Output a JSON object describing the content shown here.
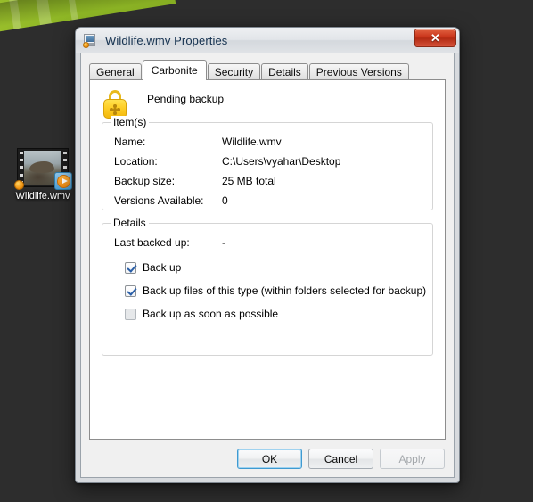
{
  "desktop": {
    "icon": {
      "label": "Wildlife.wmv",
      "thumbnail_icon": "video-thumbnail-icon",
      "play_badge_icon": "play-badge-icon",
      "backup_status_icon": "carbonite-pending-dot-icon"
    }
  },
  "dialog": {
    "title": "Wildlife.wmv Properties",
    "title_icon": "file-properties-icon",
    "close_label": "✕",
    "close_icon": "close-icon",
    "tabs": [
      {
        "label": "General",
        "active": false
      },
      {
        "label": "Carbonite",
        "active": true
      },
      {
        "label": "Security",
        "active": false
      },
      {
        "label": "Details",
        "active": false
      },
      {
        "label": "Previous Versions",
        "active": false
      }
    ],
    "status": {
      "icon": "padlock-icon",
      "text": "Pending backup"
    },
    "items_group": {
      "title": "Item(s)",
      "rows": [
        {
          "key": "Name:",
          "value": "Wildlife.wmv"
        },
        {
          "key": "Location:",
          "value": "C:\\Users\\vyahar\\Desktop"
        },
        {
          "key": "Backup size:",
          "value": "25 MB total"
        },
        {
          "key": "Versions Available:",
          "value": "0"
        }
      ]
    },
    "details_group": {
      "title": "Details",
      "last_backed_up": {
        "key": "Last backed up:",
        "value": "-"
      },
      "checkboxes": [
        {
          "label": "Back up",
          "checked": true,
          "enabled": true
        },
        {
          "label": "Back up files of this type (within folders selected for backup)",
          "checked": true,
          "enabled": true
        },
        {
          "label": "Back up as soon as possible",
          "checked": false,
          "enabled": false
        }
      ]
    },
    "buttons": [
      {
        "label": "OK",
        "state": "default"
      },
      {
        "label": "Cancel",
        "state": "normal"
      },
      {
        "label": "Apply",
        "state": "disabled"
      }
    ]
  },
  "colors": {
    "desktop": "#2d2d2d",
    "wallpaper_green": "#8fb726",
    "accent_blue": "#3f9ad1",
    "close_red": "#c8341a",
    "lock_gold": "#ffd02a"
  }
}
